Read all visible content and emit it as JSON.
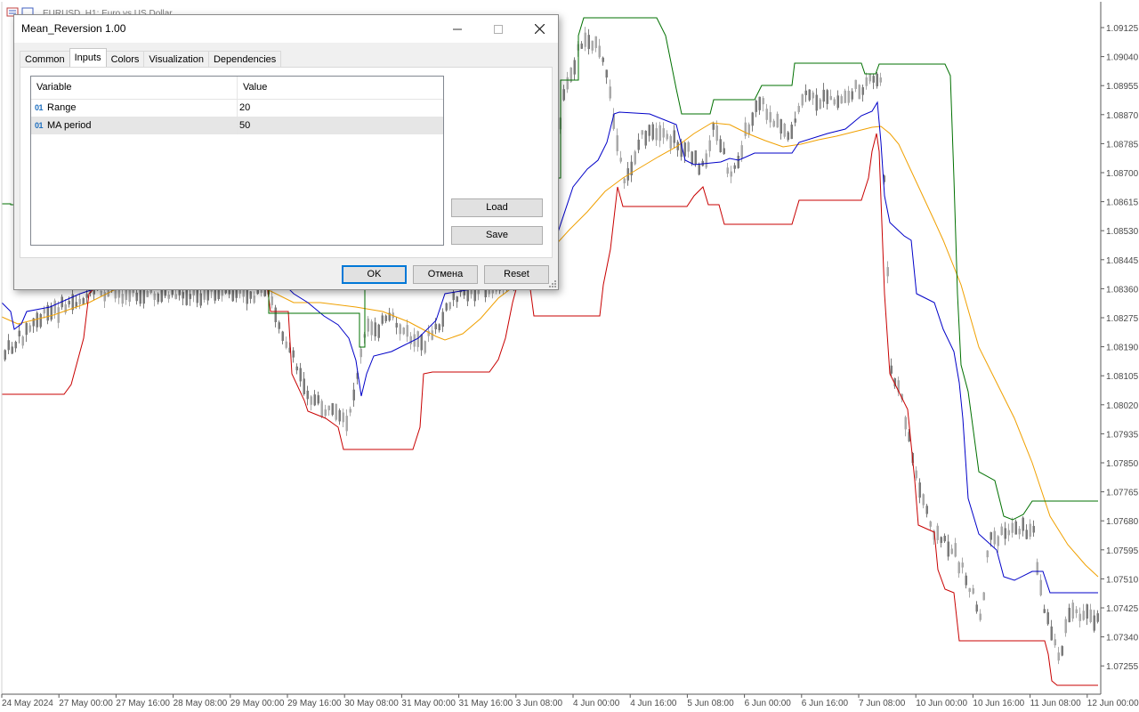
{
  "chart_window": {
    "title": "EURUSD, H1:  Euro vs US Dollar"
  },
  "price_axis": {
    "labels": [
      "1.09125",
      "1.09040",
      "1.08955",
      "1.08870",
      "1.08785",
      "1.08700",
      "1.08615",
      "1.08530",
      "1.08445",
      "1.08360",
      "1.08275",
      "1.08190",
      "1.08105",
      "1.08020",
      "1.07935",
      "1.07850",
      "1.07765",
      "1.07680",
      "1.07595",
      "1.07510",
      "1.07425",
      "1.07340",
      "1.07255"
    ]
  },
  "time_axis": {
    "labels": [
      "24 May 2024",
      "27 May 00:00",
      "27 May 16:00",
      "28 May 08:00",
      "29 May 00:00",
      "29 May 16:00",
      "30 May 08:00",
      "31 May 00:00",
      "31 May 16:00",
      "3 Jun 08:00",
      "4 Jun 00:00",
      "4 Jun 16:00",
      "5 Jun 08:00",
      "6 Jun 00:00",
      "6 Jun 16:00",
      "7 Jun 08:00",
      "10 Jun 00:00",
      "10 Jun 16:00",
      "11 Jun 08:00",
      "12 Jun 00:00"
    ]
  },
  "indicator_lines": {
    "upper_color": "#007000",
    "middle_color": "#0000c8",
    "lower_color": "#c80000",
    "ma_color": "#f0a000",
    "candle_color": "#8a8a8a"
  },
  "dialog": {
    "title": "Mean_Reversion 1.00",
    "tabs": [
      "Common",
      "Inputs",
      "Colors",
      "Visualization",
      "Dependencies"
    ],
    "active_tab": "Inputs",
    "columns": {
      "variable": "Variable",
      "value": "Value"
    },
    "rows": [
      {
        "type": "01",
        "name": "Range",
        "value": "20"
      },
      {
        "type": "01",
        "name": "MA period",
        "value": "50"
      }
    ],
    "load_label": "Load",
    "save_label": "Save",
    "ok_label": "OK",
    "cancel_label": "Отмена",
    "reset_label": "Reset"
  }
}
